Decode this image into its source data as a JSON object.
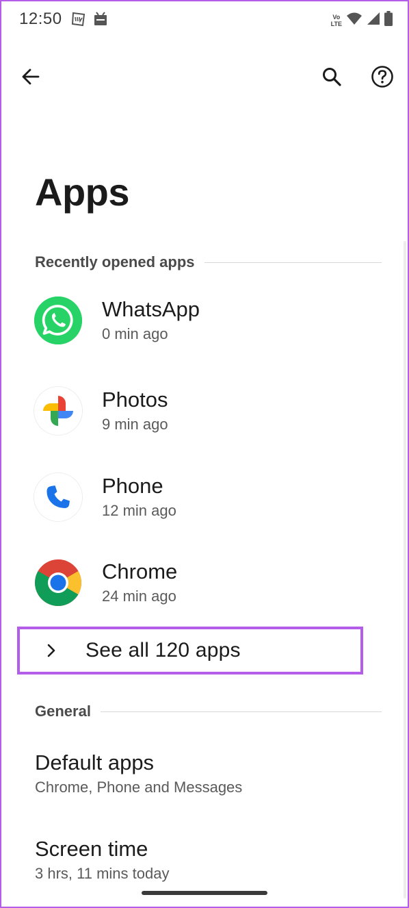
{
  "status_bar": {
    "time": "12:50",
    "volte_top": "Vo",
    "volte_bottom": "LTE"
  },
  "app_bar": {
    "back_icon": "arrow-left-icon",
    "search_icon": "search-icon",
    "help_icon": "help-circle-icon"
  },
  "page": {
    "title": "Apps"
  },
  "recent": {
    "header": "Recently opened apps",
    "apps": [
      {
        "name": "WhatsApp",
        "time": "0 min ago",
        "icon": "whatsapp-icon",
        "color": "#25D366"
      },
      {
        "name": "Photos",
        "time": "9 min ago",
        "icon": "photos-icon",
        "color": "#4285F4"
      },
      {
        "name": "Phone",
        "time": "12 min ago",
        "icon": "phone-icon",
        "color": "#1A73E8"
      },
      {
        "name": "Chrome",
        "time": "24 min ago",
        "icon": "chrome-icon",
        "color": "#DB4437"
      }
    ],
    "see_all": "See all 120 apps"
  },
  "general": {
    "header": "General",
    "items": [
      {
        "title": "Default apps",
        "subtitle": "Chrome, Phone and Messages"
      },
      {
        "title": "Screen time",
        "subtitle": "3 hrs, 11 mins today"
      }
    ]
  },
  "colors": {
    "highlight": "#B45DE8"
  }
}
